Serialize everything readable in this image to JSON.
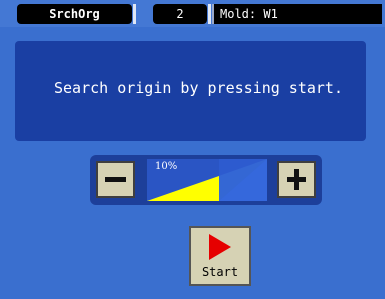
{
  "topbar": {
    "screen_name": "SrchOrg",
    "page_number": "2",
    "mold_label": "Mold: W1"
  },
  "message": {
    "text": "Search origin by pressing start."
  },
  "speed": {
    "value_label": "10%",
    "minus_icon": "minus-icon",
    "plus_icon": "plus-icon",
    "gauge_fill_color": "#ffff00"
  },
  "start_button": {
    "label": "Start",
    "icon": "play-icon",
    "icon_color": "#e60000"
  },
  "colors": {
    "background": "#3a6fcf",
    "panel": "#1a3fa3",
    "button_face": "#d6d2b4"
  }
}
